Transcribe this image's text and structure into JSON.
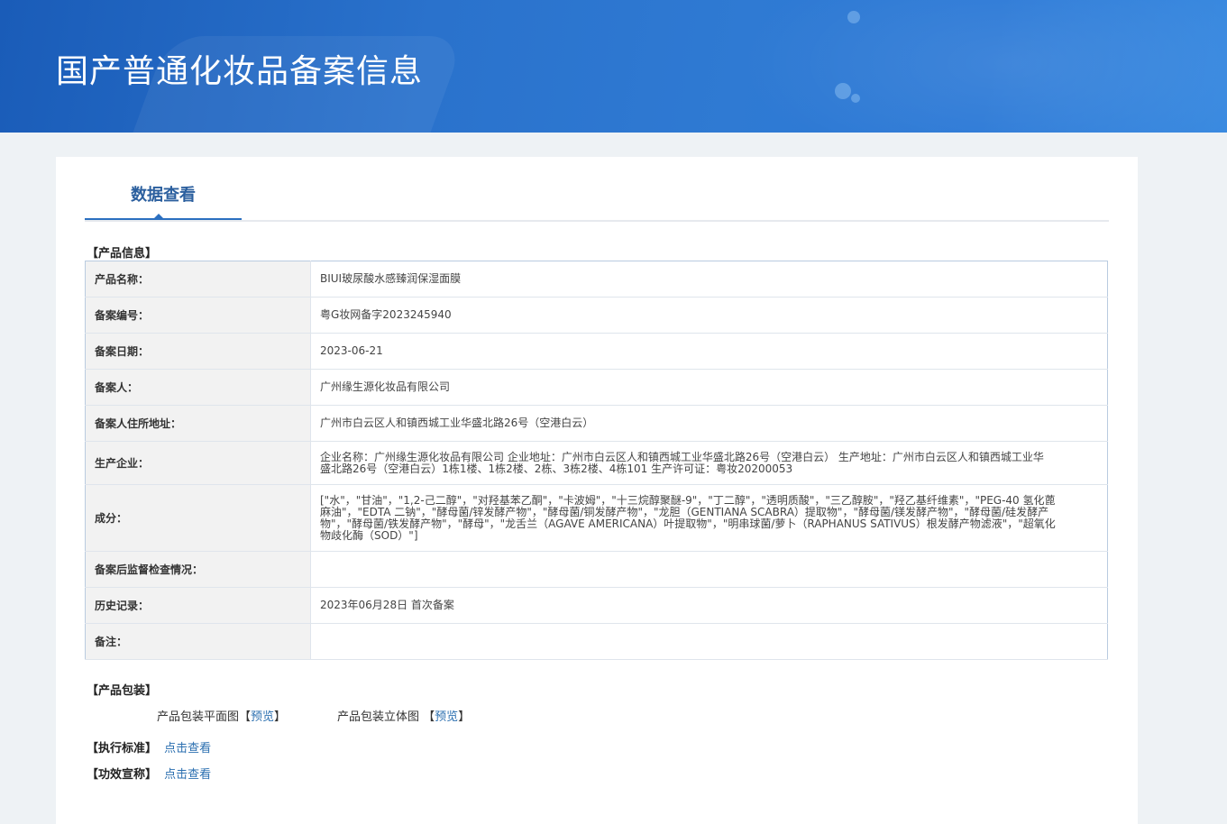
{
  "banner": {
    "title": "国产普通化妆品备案信息"
  },
  "tabs": [
    {
      "label": "数据查看"
    }
  ],
  "sections": {
    "product_info": "【产品信息】",
    "packaging": "【产品包装】",
    "standard": "【执行标准】",
    "efficacy": "【功效宣称】"
  },
  "rows": [
    {
      "key": "产品名称：",
      "value": "BIUI玻尿酸水感臻润保湿面膜"
    },
    {
      "key": "备案编号：",
      "value": "粤G妆网备字2023245940"
    },
    {
      "key": "备案日期：",
      "value": "2023-06-21"
    },
    {
      "key": "备案人：",
      "value": "广州缘生源化妆品有限公司"
    },
    {
      "key": "备案人住所地址：",
      "value": "广州市白云区人和镇西城工业华盛北路26号（空港白云）"
    },
    {
      "key": "生产企业：",
      "value": "企业名称：广州缘生源化妆品有限公司 企业地址：广州市白云区人和镇西城工业华盛北路26号（空港白云） 生产地址：广州市白云区人和镇西城工业华盛北路26号（空港白云）1栋1楼、1栋2楼、2栋、3栋2楼、4栋101 生产许可证：粤妆20200053"
    },
    {
      "key": "成分：",
      "value": "[\"水\"，\"甘油\"，\"1,2-己二醇\"，\"对羟基苯乙酮\"，\"卡波姆\"，\"十三烷醇聚醚-9\"，\"丁二醇\"，\"透明质酸\"，\"三乙醇胺\"，\"羟乙基纤维素\"，\"PEG-40 氢化蓖麻油\"，\"EDTA 二钠\"，\"酵母菌/锌发酵产物\"，\"酵母菌/铜发酵产物\"，\"龙胆（GENTIANA SCABRA）提取物\"，\"酵母菌/镁发酵产物\"，\"酵母菌/硅发酵产物\"，\"酵母菌/铁发酵产物\"，\"酵母\"，\"龙舌兰（AGAVE AMERICANA）叶提取物\"，\"明串球菌/萝卜（RAPHANUS SATIVUS）根发酵产物滤液\"，\"超氧化物歧化酶（SOD）\"]"
    },
    {
      "key": "备案后监督检查情况：",
      "value": ""
    },
    {
      "key": "历史记录：",
      "value": "2023年06月28日 首次备案"
    },
    {
      "key": "备注：",
      "value": ""
    }
  ],
  "packaging": {
    "flat_label": "产品包装平面图",
    "solid_label": "产品包装立体图",
    "preview_open": "【",
    "preview_link": "预览",
    "preview_close": "】"
  },
  "standard": {
    "link": "点击查看"
  },
  "efficacy": {
    "link": "点击查看"
  }
}
